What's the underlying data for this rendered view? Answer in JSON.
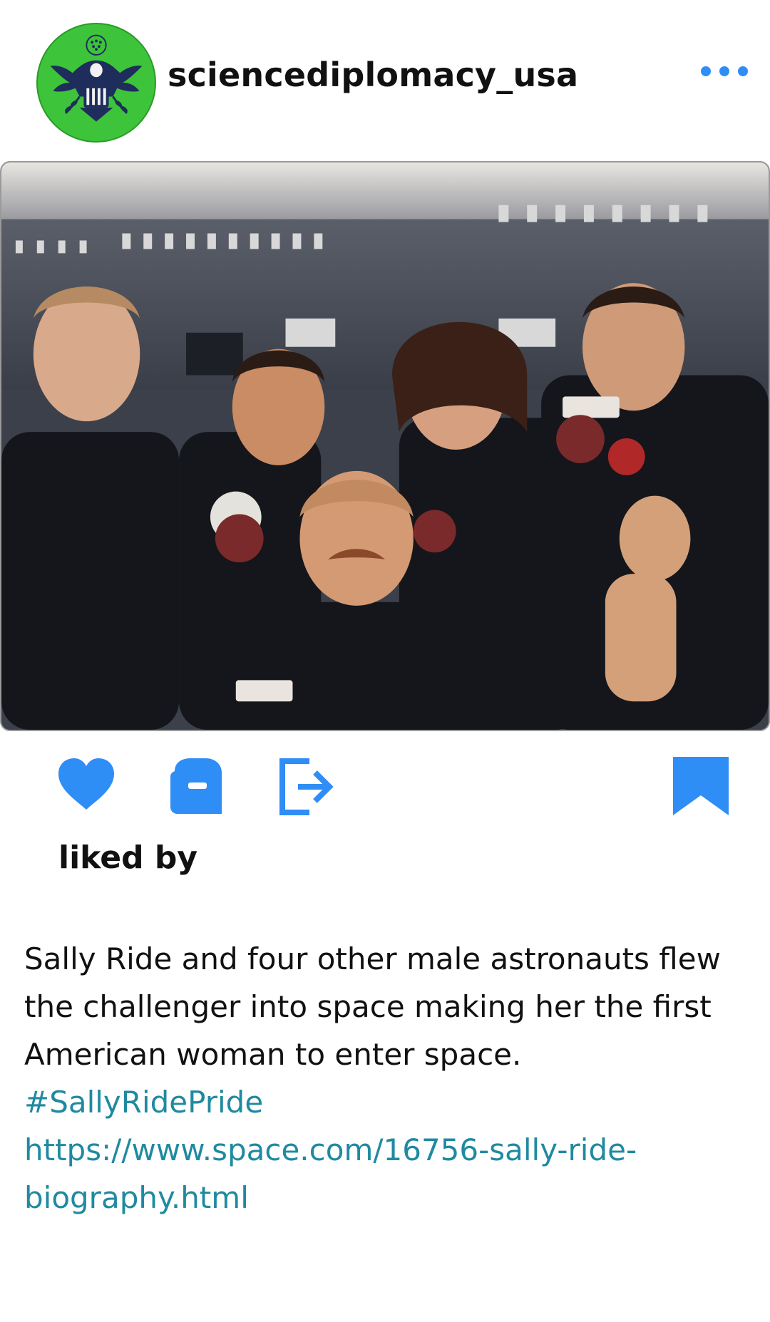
{
  "post": {
    "username": "sciencediplomacy_usa",
    "avatar_icon": "great-seal-icon",
    "more_icon": "more-horizontal-icon",
    "photo_description_icon": "astronaut-crew-photo",
    "actions": {
      "like_icon": "heart-icon",
      "comment_icon": "comment-icon",
      "share_icon": "share-icon",
      "save_icon": "bookmark-icon"
    },
    "likes_label": "liked by",
    "caption_lines": [
      "Sally Ride and four other male astronauts flew",
      "the challenger into space making her the first",
      "American woman to enter space."
    ],
    "hashtag": "#SallyRidePride",
    "link_lines": [
      "https://www.space.com/16756-sally-ride-",
      "biography.html"
    ],
    "colors": {
      "accent": "#2f8df6",
      "link": "#1f8aa0",
      "avatar_bg": "#3ec43a",
      "text": "#111111"
    }
  }
}
